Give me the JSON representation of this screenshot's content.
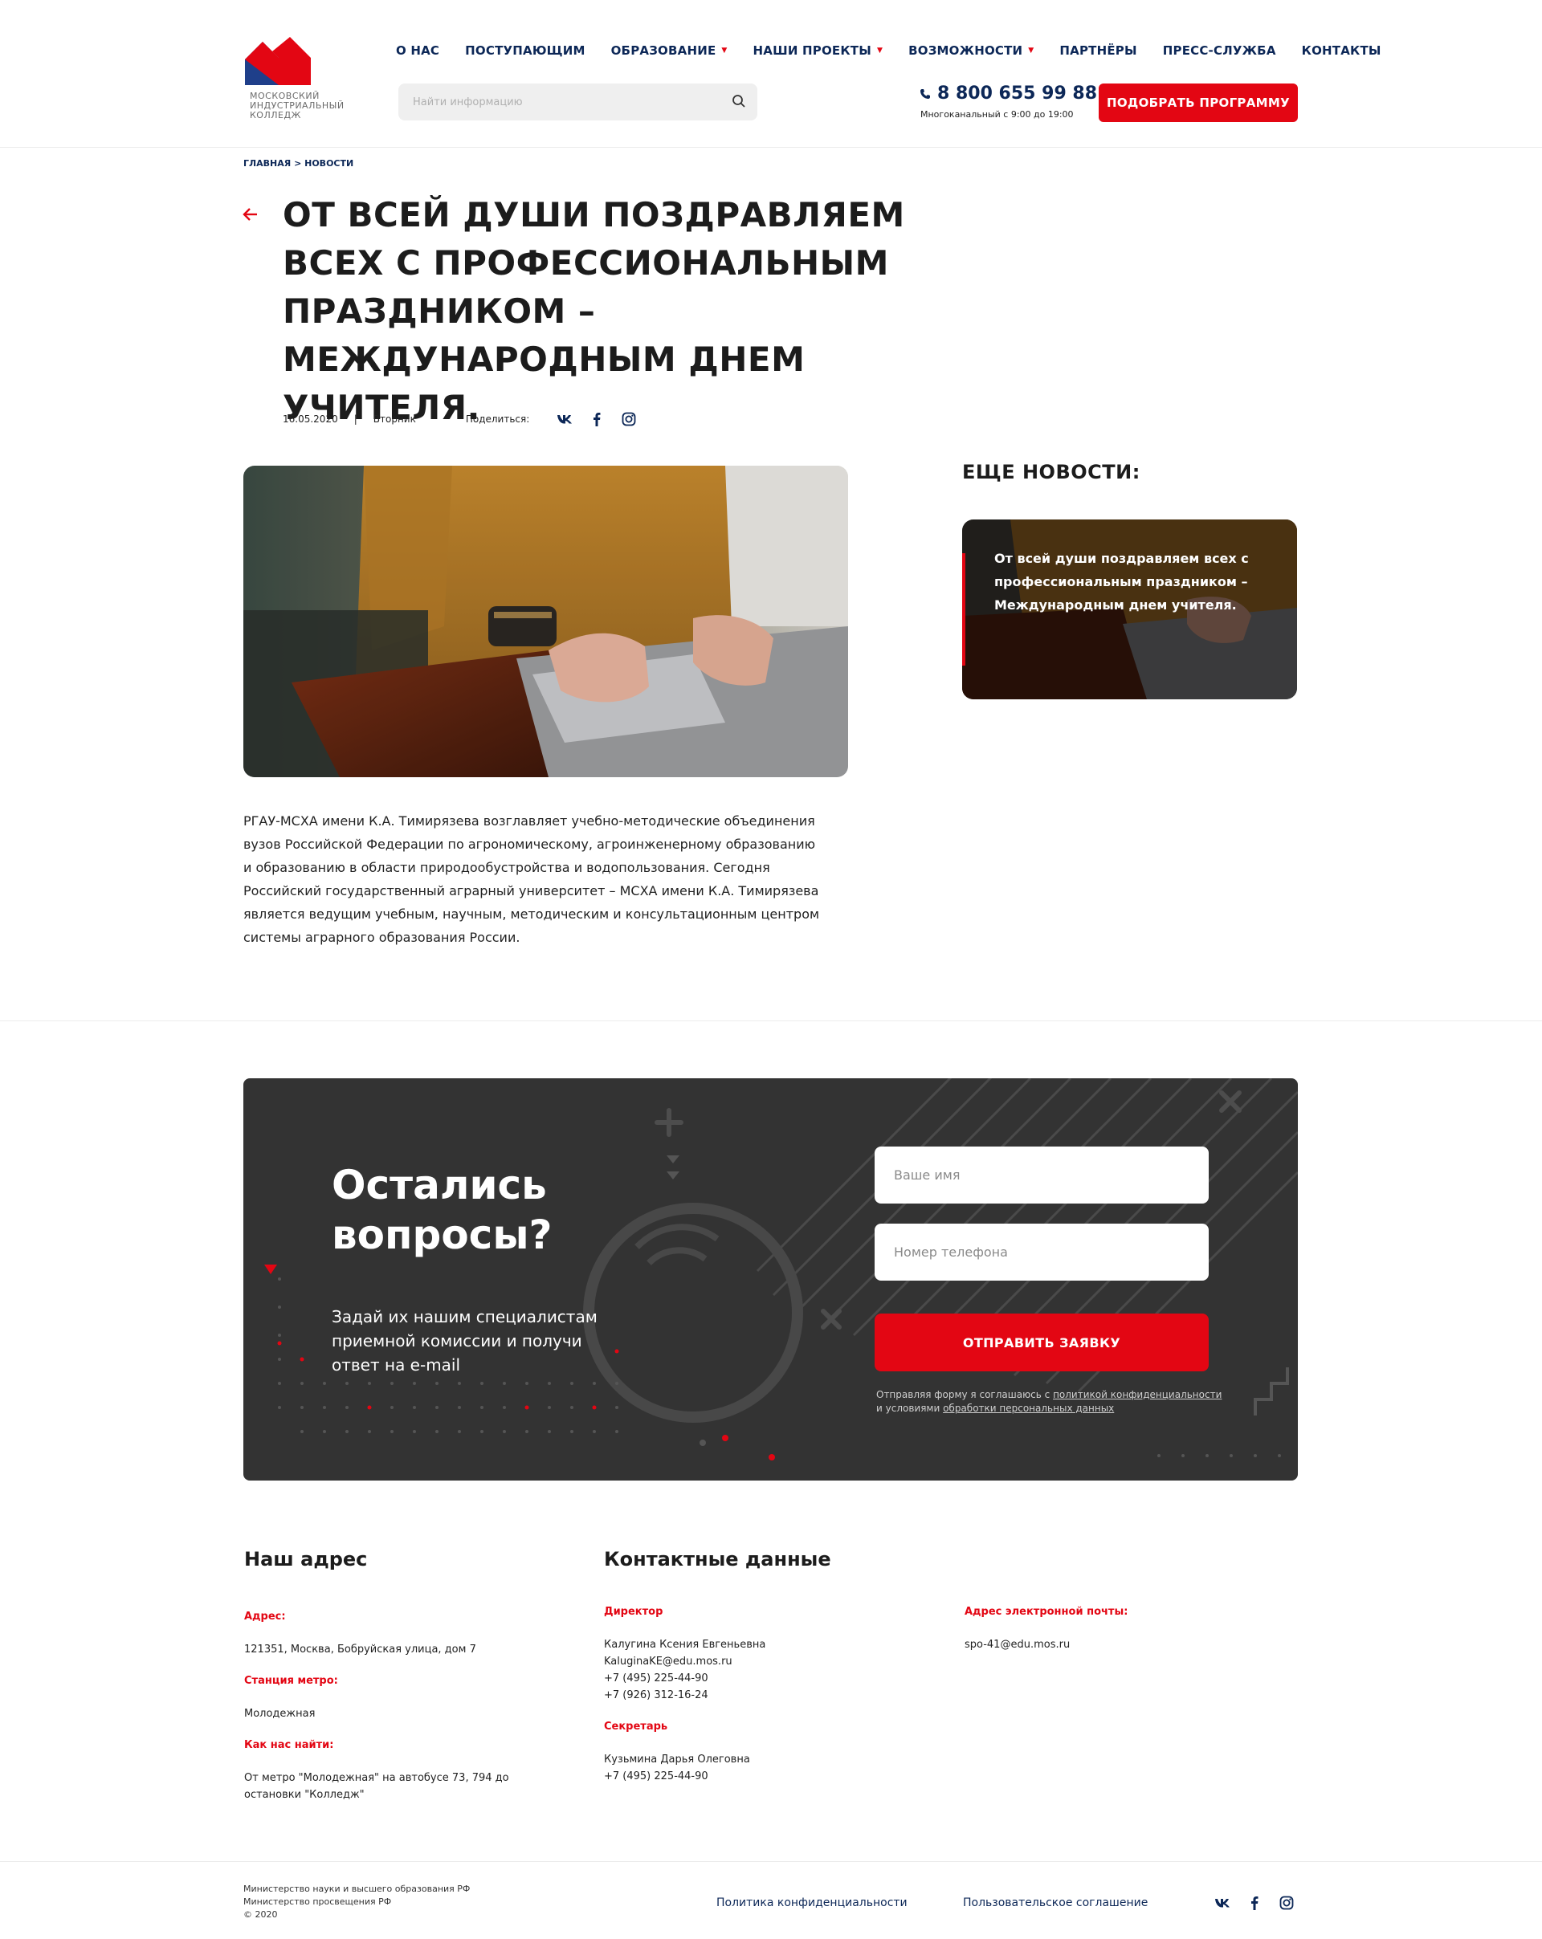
{
  "header": {
    "logo_text": "МОСКОВСКИЙ\nИНДУСТРИАЛЬНЫЙ\nКОЛЛЕДЖ",
    "nav": [
      {
        "label": "О НАС",
        "dropdown": false
      },
      {
        "label": "ПОСТУПАЮЩИМ",
        "dropdown": false
      },
      {
        "label": "ОБРАЗОВАНИЕ",
        "dropdown": true
      },
      {
        "label": "НАШИ ПРОЕКТЫ",
        "dropdown": true
      },
      {
        "label": "ВОЗМОЖНОСТИ",
        "dropdown": true
      },
      {
        "label": "ПАРТНЁРЫ",
        "dropdown": false
      },
      {
        "label": "ПРЕСС-СЛУЖБА",
        "dropdown": false
      },
      {
        "label": "КОНТАКТЫ",
        "dropdown": false
      }
    ],
    "search_placeholder": "Найти информацию",
    "phone": "8 800 655 99 88",
    "phone_note": "Многоканальный с 9:00 до 19:00",
    "cta_label": "ПОДОБРАТЬ ПРОГРАММУ"
  },
  "breadcrumb": {
    "home": "ГЛАВНАЯ",
    "separator": " > ",
    "current": "НОВОСТИ"
  },
  "article": {
    "title": "ОТ ВСЕЙ ДУШИ ПОЗДРАВЛЯЕМ ВСЕХ С ПРОФЕССИОНАЛЬНЫМ ПРАЗДНИКОМ –  МЕЖДУНАРОДНЫМ ДНЕМ УЧИТЕЛЯ.",
    "date": "16.05.2020",
    "separator": "|",
    "weekday": "Вторник",
    "share_label": "Поделиться:",
    "body": "РГАУ-МСХА имени К.А. Тимирязева возглавляет учебно-методические объединения вузов Российской Федерации по агрономическому, агроинженерному образованию и образованию в области природообустройства и водопользования. Сегодня Российский государственный аграрный университет – МСХА имени К.А. Тимирязева является ведущим учебным, научным, методическим и консультационным центром системы аграрного образования России."
  },
  "sidebar": {
    "title": "ЕЩЕ НОВОСТИ:",
    "cards": [
      {
        "text": "От всей души поздравляем всех с профессиональным праздником – Международным днем учителя."
      }
    ]
  },
  "questions": {
    "title": "Остались вопросы?",
    "subtitle": "Задай их нашим специалистам приемной комиссии и получи ответ на e-mail",
    "name_placeholder": "Ваше имя",
    "phone_placeholder": "Номер телефона",
    "submit_label": "ОТПРАВИТЬ ЗАЯВКУ",
    "consent_prefix": "Отправляя форму я соглашаюсь с ",
    "consent_link1": "политикой конфиденциальности",
    "consent_mid": " и условиями ",
    "consent_link2": "обработки персональных данных"
  },
  "contacts": {
    "address_heading": "Наш адрес",
    "address_label": "Адрес:",
    "address_value": "121351, Москва, Бобруйская улица, дом 7",
    "metro_label": "Станция метро:",
    "metro_value": "Молодежная",
    "route_label": "Как нас найти:",
    "route_value": "От метро \"Молодежная\" на автобусе 73, 794 до остановки \"Колледж\"",
    "contact_heading": "Контактные данные",
    "director_label": "Директор",
    "director_name": "Калугина Ксения Евгеньевна",
    "director_email": "KaluginaKE@edu.mos.ru",
    "director_phone1": "+7 (495) 225-44-90",
    "director_phone2": "+7 (926) 312-16-24",
    "secretary_label": "Секретарь",
    "secretary_name": "Кузьмина Дарья Олеговна",
    "secretary_phone": "+7 (495) 225-44-90",
    "email_label": "Адрес электронной почты:",
    "email_value": "spo-41@edu.mos.ru"
  },
  "footer": {
    "line1": "Министерство науки и высшего образования РФ",
    "line2": "Министерство просвещения РФ",
    "line3": "© 2020",
    "privacy": "Политика конфиденциальности",
    "agreement": "Пользовательское соглашение"
  },
  "colors": {
    "accent": "#e30613",
    "navy": "#0c2757",
    "panel": "#333333"
  }
}
